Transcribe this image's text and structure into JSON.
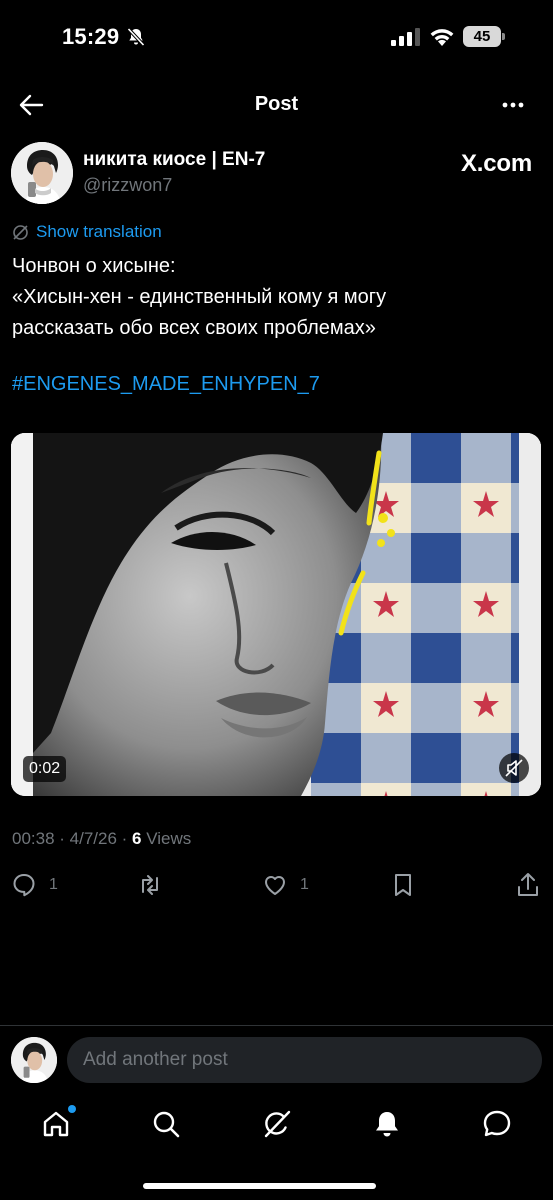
{
  "status_bar": {
    "time": "15:29",
    "battery": "45",
    "icons": [
      "bell-off-icon",
      "signal-icon",
      "wifi-icon",
      "battery-icon"
    ]
  },
  "header": {
    "title": "Post",
    "icons": [
      "back-arrow-icon",
      "more-icon"
    ]
  },
  "post": {
    "author": {
      "display_name": "никита киосе | EN-7",
      "handle": "@rizzwon7"
    },
    "watermark": "X.com",
    "translate_label": "Show translation",
    "text_lines": [
      "Чонвон о хисыне:",
      "«Хисын-хен - единственный кому я могу",
      "рассказать обо всех своих проблемах»"
    ],
    "hashtag": "#ENGENES_MADE_ENHYPEN_7",
    "media": {
      "duration": "0:02",
      "muted": true
    },
    "meta": {
      "time_date": "00:38 · 4/7/26 · ",
      "views_count": "6",
      "views_label": " Views"
    },
    "actions": {
      "replies": "1",
      "reposts": "",
      "likes": "1",
      "icons": [
        "reply-icon",
        "repost-icon",
        "like-icon",
        "bookmark-icon",
        "share-icon"
      ]
    }
  },
  "composer": {
    "placeholder": "Add another post",
    "value": ""
  },
  "tab_bar": {
    "items": [
      "home-icon",
      "search-icon",
      "grok-icon",
      "notifications-icon",
      "messages-icon"
    ],
    "home_has_badge": true
  },
  "colors": {
    "background": "#000000",
    "text": "#e7e9ea",
    "secondary_text": "#71767b",
    "accent": "#1d9bf0",
    "divider": "#2f3336",
    "input_bg": "#202327"
  }
}
